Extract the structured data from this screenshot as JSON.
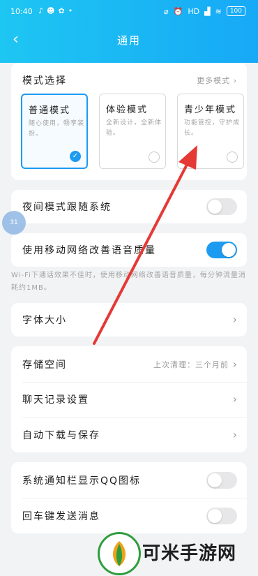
{
  "status_bar": {
    "time": "10:40",
    "left_icons": [
      "bell-icon",
      "cat-icon",
      "flower-icon",
      "dot-icon"
    ],
    "network": "HD",
    "battery": "100"
  },
  "header": {
    "title": "通用"
  },
  "mode": {
    "label": "模式选择",
    "more": "更多模式",
    "tiles": [
      {
        "name": "普通模式",
        "desc": "随心使用，畅享装扮。",
        "selected": true
      },
      {
        "name": "体验模式",
        "desc": "全新设计，全新体验。",
        "selected": false
      },
      {
        "name": "青少年模式",
        "desc": "功能管控，守护成长。",
        "selected": false
      }
    ]
  },
  "night_mode": {
    "label": "夜间模式跟随系统",
    "on": false
  },
  "mobile_voice": {
    "label": "使用移动网络改善语音质量",
    "on": true
  },
  "note": "Wi-Fi下通话效果不佳时，使用移动网络改善语音质量，每分钟流量消耗约1MB。",
  "font_size": {
    "label": "字体大小"
  },
  "storage": {
    "label": "存储空间",
    "sub": "上次清理：三个月前"
  },
  "chat_history": {
    "label": "聊天记录设置"
  },
  "auto_download": {
    "label": "自动下载与保存"
  },
  "notif_icon": {
    "label": "系统通知栏显示QQ图标",
    "on": false
  },
  "enter_send": {
    "label": "回车键发送消息",
    "on": false
  },
  "bubble": {
    "text": "31"
  },
  "watermark": {
    "text": "可米手游网"
  },
  "colors": {
    "accent": "#1d9bf0",
    "header_start": "#1ec6f2",
    "header_end": "#17a9f6",
    "arrow": "#e53935"
  }
}
